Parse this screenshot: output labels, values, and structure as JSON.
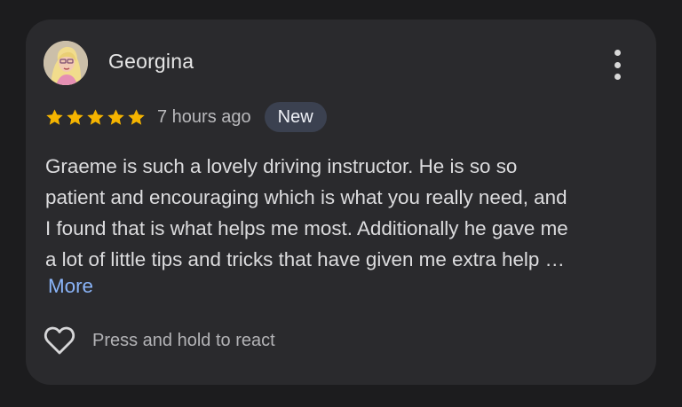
{
  "review": {
    "author_name": "Georgina",
    "rating": 5,
    "rating_max": 5,
    "time_ago": "7 hours ago",
    "badge": "New",
    "text_lines": [
      "Graeme is such a lovely driving instructor. He is so so",
      "patient and encouraging which is what you really need, and",
      "I found that is what helps me most. Additionally he gave me",
      "a lot of little tips and tricks that have given me extra help …"
    ],
    "more_label": "More",
    "react_label": "Press and hold to react"
  },
  "icons": {
    "menu": "more-vert-icon",
    "star": "star-icon",
    "heart": "heart-outline-icon"
  },
  "colors": {
    "background": "#1c1c1e",
    "card": "#2a2a2d",
    "star": "#f5b400",
    "badge_bg": "#3b4150",
    "link": "#8ab4f8"
  }
}
